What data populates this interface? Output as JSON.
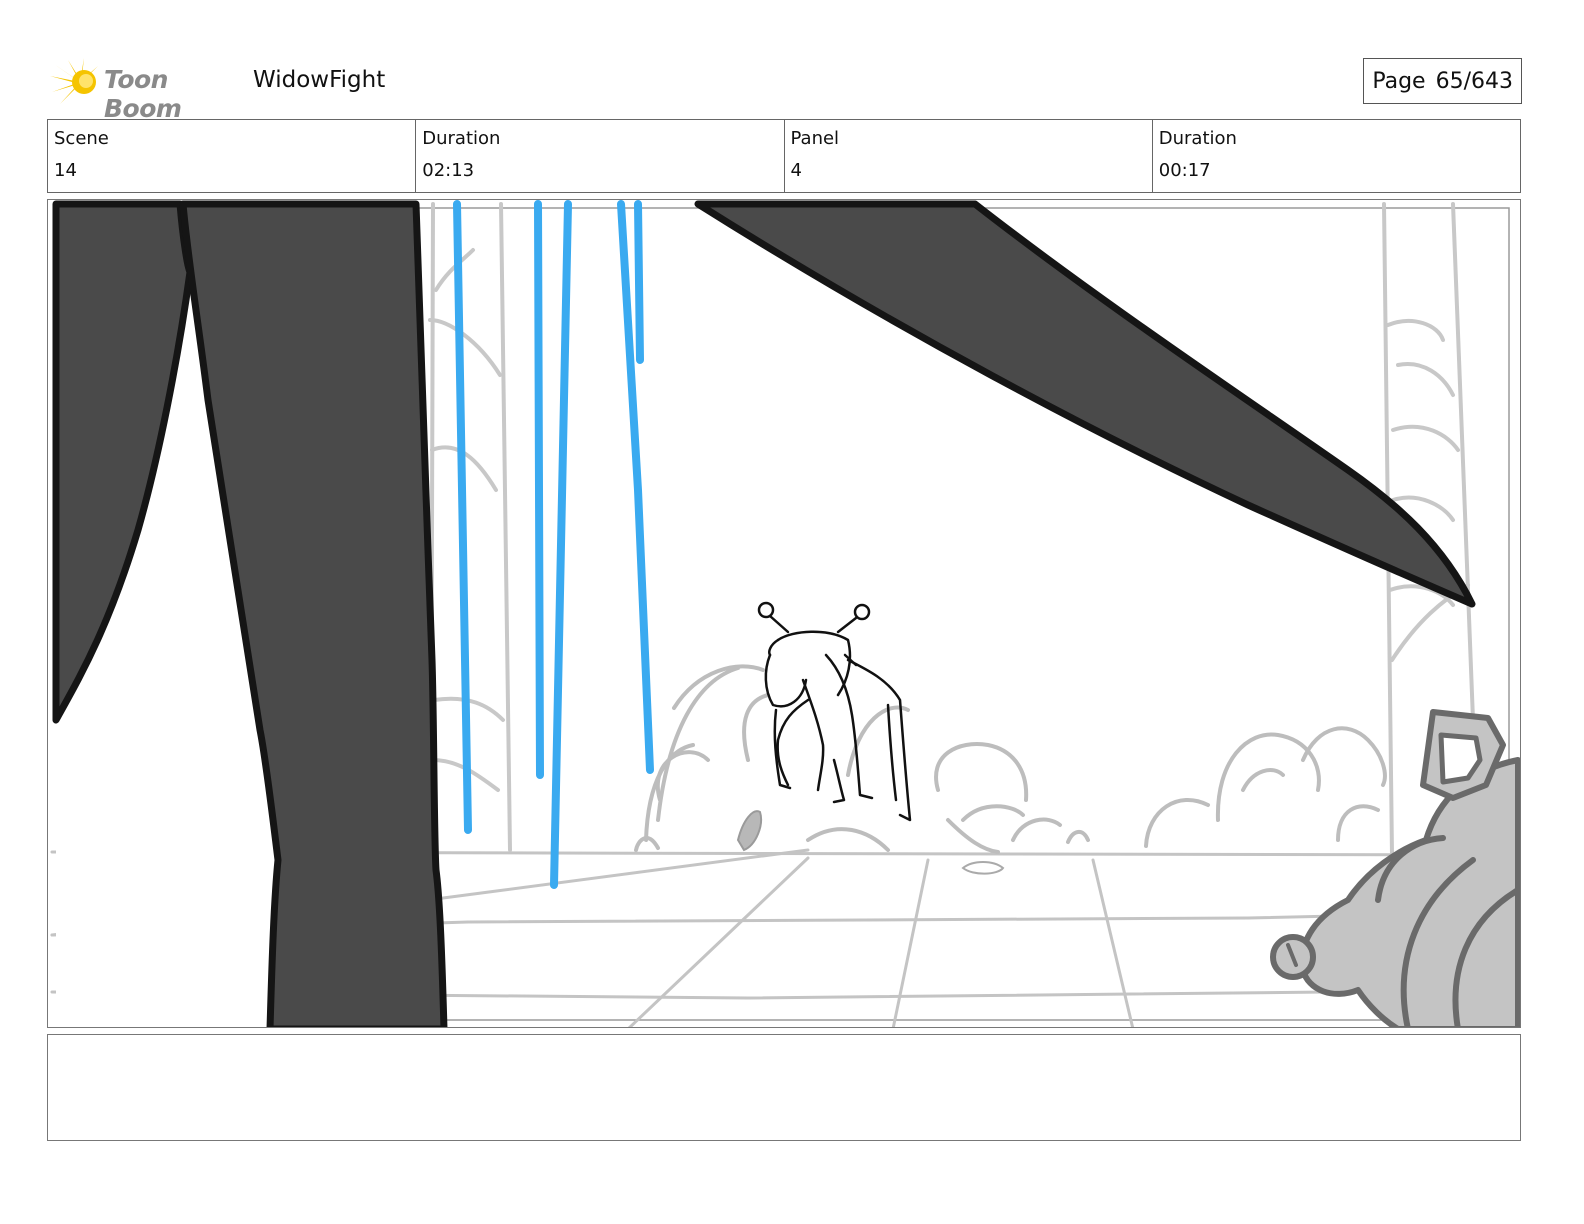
{
  "header": {
    "logo_text": "Toon Boom",
    "project_title": "WidowFight",
    "page_label": "Page",
    "page_number": "65/643"
  },
  "info": {
    "scene_label": "Scene",
    "scene_value": "14",
    "scene_duration_label": "Duration",
    "scene_duration_value": "02:13",
    "panel_label": "Panel",
    "panel_value": "4",
    "panel_duration_label": "Duration",
    "panel_duration_value": "00:17"
  },
  "notes": {
    "text": ""
  },
  "colors": {
    "accent_blue": "#3aaaf0",
    "dark_fill": "#4a4a4a",
    "sketch_gray": "#c4c4c4",
    "logo_yellow": "#f5c400"
  }
}
